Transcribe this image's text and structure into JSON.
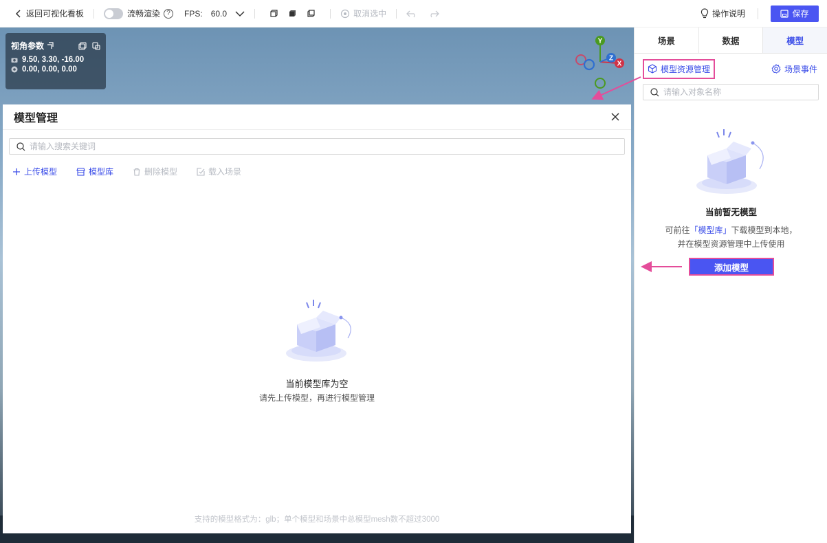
{
  "toolbar": {
    "back_label": "返回可视化看板",
    "smooth_render_label": "流畅渲染",
    "help_glyph": "?",
    "fps_label": "FPS:",
    "fps_value": "60.0",
    "deselect_label": "取消选中",
    "guide_label": "操作说明",
    "save_label": "保存"
  },
  "view_params": {
    "title": "视角参数",
    "camera_position": "9.50, 3.30, -16.00",
    "target_position": "0.00, 0.00, 0.00"
  },
  "gizmo": {
    "y": "Y",
    "z": "Z",
    "x": "X"
  },
  "modal": {
    "title": "模型管理",
    "search_placeholder": "请输入搜索关键词",
    "actions": {
      "upload": "上传模型",
      "library": "模型库",
      "delete": "删除模型",
      "load_scene": "载入场景"
    },
    "empty_title": "当前模型库为空",
    "empty_subtitle": "请先上传模型，再进行模型管理",
    "footer_note": "支持的模型格式为：glb；单个模型和场景中总模型mesh数不超过3000"
  },
  "right_panel": {
    "tabs": [
      {
        "label": "场景",
        "active": false
      },
      {
        "label": "数据",
        "active": false
      },
      {
        "label": "模型",
        "active": true
      }
    ],
    "model_resource_label": "模型资源管理",
    "scene_event_label": "场景事件",
    "search_placeholder": "请输入对象名称",
    "empty_title": "当前暂无模型",
    "empty_line1_prefix": "可前往",
    "empty_line1_link": "「模型库」",
    "empty_line1_suffix": "下载模型到本地，",
    "empty_line2": "并在模型资源管理中上传使用",
    "add_model_label": "添加模型"
  },
  "colors": {
    "accent": "#4a55f2",
    "link": "#3a4ce8",
    "highlight_border": "#e44d9a"
  }
}
